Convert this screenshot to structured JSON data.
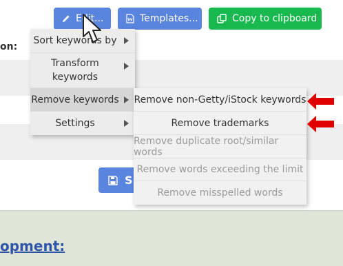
{
  "toolbar": {
    "edit_label": "Edit...",
    "templates_label": "Templates...",
    "copy_label": "Copy to clipboard"
  },
  "page": {
    "label_fragment": "on:",
    "heading_fragment": "opment:",
    "save_fragment": "S"
  },
  "menu": {
    "items": [
      {
        "label": "Sort keywords by",
        "has_submenu": true
      },
      {
        "label": "Transform keywords",
        "has_submenu": true
      },
      {
        "label": "Remove keywords",
        "has_submenu": true,
        "active": true
      },
      {
        "label": "Settings",
        "has_submenu": true
      }
    ]
  },
  "submenu": {
    "items": [
      {
        "label": "Remove non-Getty/iStock keywords",
        "enabled": true,
        "highlighted_by_arrow": true
      },
      {
        "label": "Remove trademarks",
        "enabled": true,
        "highlighted_by_arrow": true
      },
      {
        "label": "Remove duplicate root/similar words",
        "enabled": false
      },
      {
        "label": "Remove words exceeding the limit",
        "enabled": false
      },
      {
        "label": "Remove misspelled words",
        "enabled": false
      }
    ]
  },
  "colors": {
    "primary_button": "#5a85de",
    "copy_button": "#18b94f",
    "annotation_arrow": "#e00000",
    "heading_link": "#2f56a8"
  },
  "icons": [
    "pencil-icon",
    "word-document-icon",
    "copy-icon",
    "floppy-disk-icon",
    "chevron-right-icon",
    "mouse-pointer-icon",
    "red-arrow-icon"
  ]
}
